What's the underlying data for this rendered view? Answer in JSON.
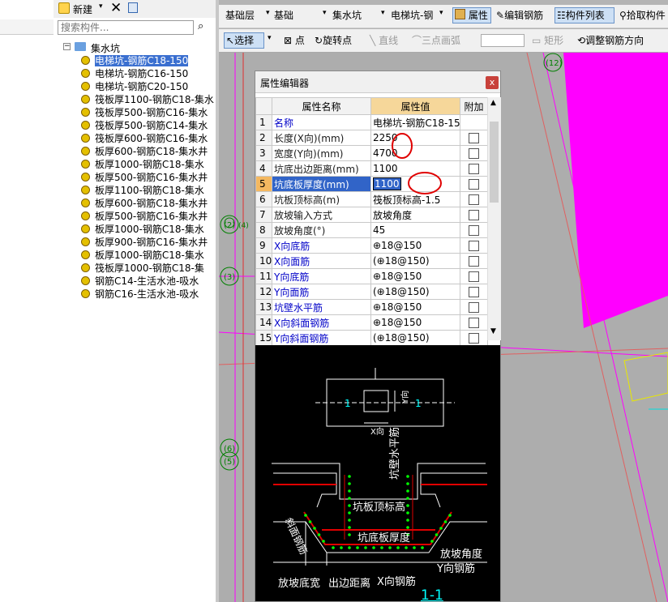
{
  "toolbar_left": {
    "new_label": "新建",
    "search_placeholder": "搜索构件..."
  },
  "tree": {
    "root": "集水坑",
    "items": [
      "电梯坑-钢筋C18-150",
      "电梯坑-钢筋C16-150",
      "电梯坑-钢筋C20-150",
      "筏板厚1100-钢筋C18-集水",
      "筏板厚500-钢筋C16-集水",
      "筏板厚500-钢筋C14-集水",
      "筏板厚600-钢筋C16-集水",
      "板厚600-钢筋C18-集水井",
      "板厚1000-钢筋C18-集水",
      "板厚500-钢筋C16-集水井",
      "板厚1100-钢筋C18-集水",
      "板厚600-钢筋C18-集水井",
      "板厚500-钢筋C16-集水井",
      "板厚1000-钢筋C18-集水",
      "板厚900-钢筋C16-集水井",
      "板厚1000-钢筋C18-集水",
      "筏板厚1000-钢筋C18-集",
      "钢筋C14-生活水池-吸水",
      "钢筋C16-生活水池-吸水"
    ]
  },
  "toolbar1": {
    "floor": "基础层",
    "category": "基础",
    "type": "集水坑",
    "component": "电梯坑-钢",
    "properties": "属性",
    "edit_rebar": "编辑钢筋",
    "component_list": "构件列表",
    "pick": "拾取构件"
  },
  "toolbar2": {
    "select": "选择",
    "point": "点",
    "rotate_point": "旋转点",
    "line": "直线",
    "arc": "三点画弧",
    "rect": "矩形",
    "adjust": "调整钢筋方向"
  },
  "dialog": {
    "title": "属性编辑器",
    "close": "x",
    "headers": [
      "属性名称",
      "属性值",
      "附加"
    ],
    "rows": [
      {
        "n": "1",
        "name": "名称",
        "value": "电梯坑-钢筋C18-15",
        "blue": true,
        "chk": false
      },
      {
        "n": "2",
        "name": "长度(X向)(mm)",
        "value": "2250",
        "blue": false,
        "chk": true
      },
      {
        "n": "3",
        "name": "宽度(Y向)(mm)",
        "value": "4700",
        "blue": false,
        "chk": true
      },
      {
        "n": "4",
        "name": "坑底出边距离(mm)",
        "value": "1100",
        "blue": false,
        "chk": true
      },
      {
        "n": "5",
        "name": "坑底板厚度(mm)",
        "value": "1100",
        "blue": false,
        "chk": true,
        "selected": true
      },
      {
        "n": "6",
        "name": "坑板顶标高(m)",
        "value": "筏板顶标高-1.5",
        "blue": false,
        "chk": true
      },
      {
        "n": "7",
        "name": "放坡输入方式",
        "value": "放坡角度",
        "blue": false,
        "chk": true
      },
      {
        "n": "8",
        "name": "放坡角度(°)",
        "value": "45",
        "blue": false,
        "chk": true
      },
      {
        "n": "9",
        "name": "X向底筋",
        "value": "⊕18@150",
        "blue": true,
        "chk": true
      },
      {
        "n": "10",
        "name": "X向面筋",
        "value": "(⊕18@150)",
        "blue": true,
        "chk": true
      },
      {
        "n": "11",
        "name": "Y向底筋",
        "value": "⊕18@150",
        "blue": true,
        "chk": true
      },
      {
        "n": "12",
        "name": "Y向面筋",
        "value": "(⊕18@150)",
        "blue": true,
        "chk": true
      },
      {
        "n": "13",
        "name": "坑壁水平筋",
        "value": "⊕18@150",
        "blue": true,
        "chk": true
      },
      {
        "n": "14",
        "name": "X向斜面钢筋",
        "value": "⊕18@150",
        "blue": true,
        "chk": true
      },
      {
        "n": "15",
        "name": "Y向斜面钢筋",
        "value": "(⊕18@150)",
        "blue": true,
        "chk": true
      }
    ]
  },
  "diagram": {
    "plan_left": "1",
    "plan_right": "1",
    "y_dir": "Y向",
    "x_dir": "X向",
    "wall_horizontal": "坑壁水平筋",
    "top_elev": "坑板顶标高",
    "slope_rebar": "斜面钢筋",
    "bottom_thick": "坑底板厚度",
    "slope_angle": "放坡角度",
    "y_rebar": "Y向钢筋",
    "slope_width": "放坡底宽",
    "edge_dist": "出边距离",
    "x_rebar": "X向钢筋",
    "section": "1-1"
  },
  "canvas": {
    "axis_labels": [
      "(12)",
      "(2)",
      "(3)",
      "(6)",
      "(5)",
      "(4)"
    ]
  },
  "colors": {
    "magenta": "#ff00ff",
    "selection": "#3164c8",
    "header_orange": "#f6d79a",
    "annotation_red": "#e00000"
  }
}
